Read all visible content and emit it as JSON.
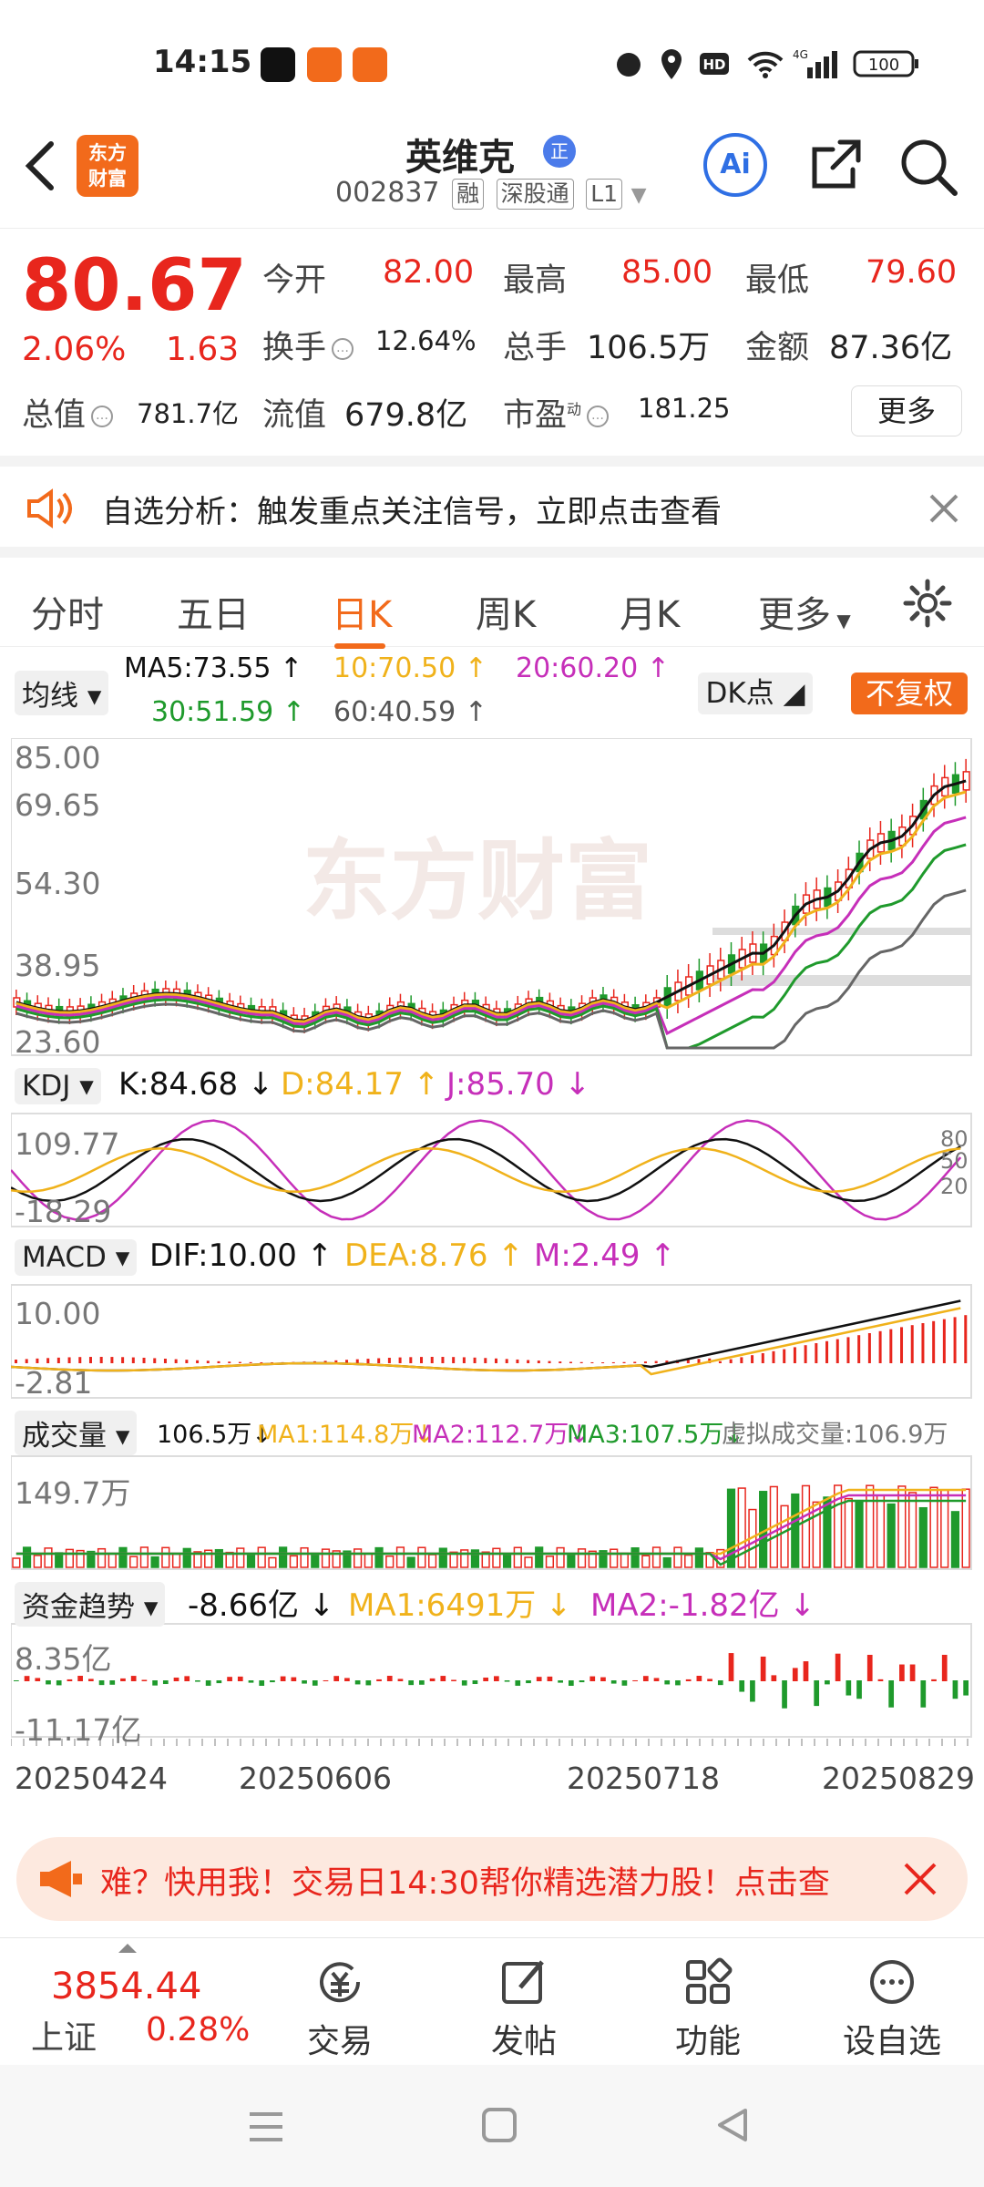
{
  "status": {
    "time": "14:15",
    "network": "4G",
    "battery": "100"
  },
  "header": {
    "logo_text_1": "东方",
    "logo_text_2": "财富",
    "name": "英维克",
    "badge": "正",
    "code": "002837",
    "tags": [
      "融",
      "深股通",
      "L1"
    ],
    "ai_label": "Ai"
  },
  "quote": {
    "price": "80.67",
    "pct": "2.06%",
    "change": "1.63",
    "open_label": "今开",
    "open": "82.00",
    "high_label": "最高",
    "high": "85.00",
    "low_label": "最低",
    "low": "79.60",
    "turnover_label": "换手",
    "turnover": "12.64%",
    "volume_label": "总手",
    "volume": "106.5万",
    "amount_label": "金额",
    "amount": "87.36亿",
    "mktcap_label": "总值",
    "mktcap": "781.7亿",
    "float_label": "流值",
    "float": "679.8亿",
    "pe_label": "市盈",
    "pe_sup": "动",
    "pe": "181.25",
    "more": "更多"
  },
  "banner": {
    "text": "自选分析：触发重点关注信号，立即点击查看"
  },
  "tabs": [
    "分时",
    "五日",
    "日K",
    "周K",
    "月K",
    "更多"
  ],
  "active_tab": "日K",
  "ma": {
    "selector": "均线",
    "ma5": "MA5:73.55",
    "ma10": "10:70.50",
    "ma20": "20:60.20",
    "ma30": "30:51.59",
    "ma60": "60:40.59",
    "dk": "DK点",
    "adjust": "不复权"
  },
  "kline_axis": [
    "85.00",
    "69.65",
    "54.30",
    "38.95",
    "23.60"
  ],
  "watermark": "东方财富",
  "kdj": {
    "selector": "KDJ",
    "k": "K:84.68",
    "d": "D:84.17",
    "j": "J:85.70",
    "axis_top": "109.77",
    "axis_bottom": "-18.29",
    "levels": [
      "80",
      "50",
      "20"
    ]
  },
  "macd": {
    "selector": "MACD",
    "dif": "DIF:10.00",
    "dea": "DEA:8.76",
    "m": "M:2.49",
    "axis_top": "10.00",
    "axis_bottom": "-2.81"
  },
  "volume": {
    "selector": "成交量",
    "current": "106.5万",
    "ma1": "MA1:114.8万",
    "ma2": "MA2:112.7万",
    "ma3": "MA3:107.5万",
    "virtual": "虚拟成交量:106.9万",
    "axis_top": "149.7万"
  },
  "fund": {
    "selector": "资金趋势",
    "current": "-8.66亿",
    "ma1": "MA1:6491万",
    "ma2": "MA2:-1.82亿",
    "axis_top": "8.35亿",
    "axis_bottom": "-11.17亿"
  },
  "dates": [
    "20250424",
    "20250606",
    "20250718",
    "20250829"
  ],
  "promo": {
    "text": "难？快用我！交易日14:30帮你精选潜力股！点击查"
  },
  "bottombar": {
    "index_value": "3854.44",
    "index_name": "上证",
    "index_pct": "0.28%",
    "items": [
      "交易",
      "发帖",
      "功能",
      "设自选"
    ]
  },
  "colors": {
    "up": "#e8261d",
    "down": "#1f9a2c",
    "accent": "#f26a1b",
    "ma5": "#111111",
    "ma10": "#f0b21b",
    "ma20": "#c62fb9",
    "ma30": "#1f9a2c",
    "ma60": "#666666"
  }
}
